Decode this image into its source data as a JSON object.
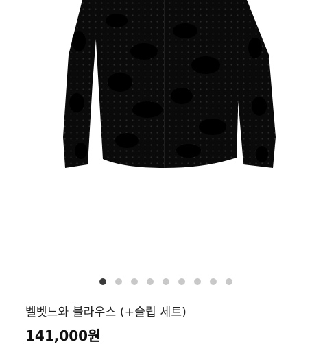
{
  "product": {
    "image_alt": "black velvet flocked sheer long-sleeve blouse",
    "title": "벨벳느와 블라우스 (+슬립 세트)",
    "price": "141,000원"
  },
  "carousel": {
    "total_slides": 9,
    "active_index": 0
  },
  "colors": {
    "dot_active": "#3a3a3a",
    "dot_inactive": "#c8c8c8",
    "text": "#222222"
  }
}
